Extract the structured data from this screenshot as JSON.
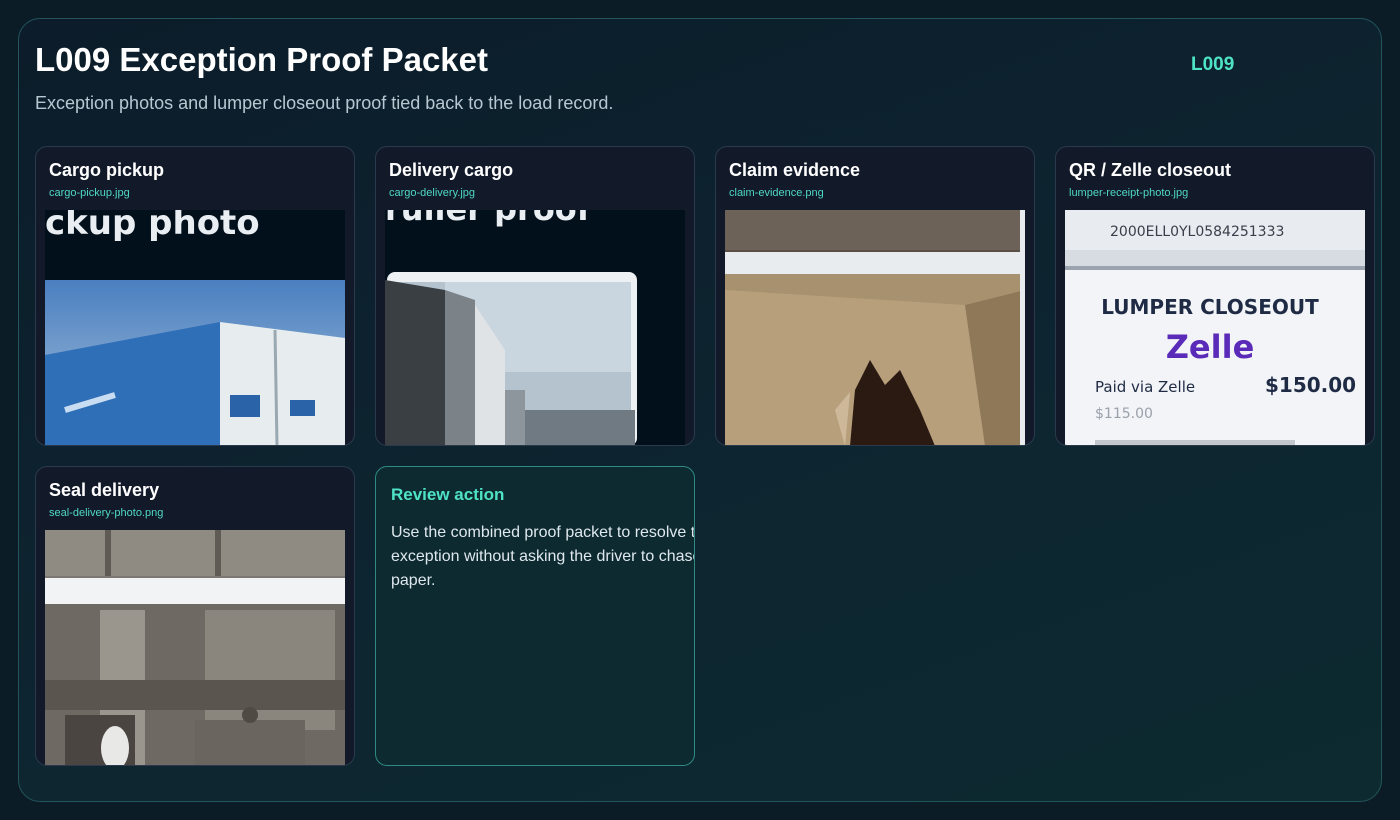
{
  "header": {
    "title": "L009 Exception Proof Packet",
    "load_id": "L009",
    "subtitle": "Exception photos and lumper closeout proof tied back to the load record."
  },
  "cards": [
    {
      "title": "Cargo pickup",
      "file": "cargo-pickup.jpg",
      "overlay_text": "ckup photo"
    },
    {
      "title": "Delivery cargo",
      "file": "cargo-delivery.jpg",
      "overlay_text": "ruller proof"
    },
    {
      "title": "Claim evidence",
      "file": "claim-evidence.png"
    },
    {
      "title": "QR / Zelle closeout",
      "file": "lumper-receipt-photo.jpg",
      "receipt": {
        "txn_id": "2000ELL0YL0584251333",
        "heading": "LUMPER CLOSEOUT",
        "brand": "Zelle",
        "paid_label": "Paid via Zelle",
        "amount": "$150.00",
        "sub_amount": "$115.00"
      }
    },
    {
      "title": "Seal delivery",
      "file": "seal-delivery-photo.png"
    }
  ],
  "review": {
    "title": "Review action",
    "text": "Use the combined proof packet to resolve the exception without asking the driver to chase paper."
  },
  "colors": {
    "accent": "#4fe3c6",
    "background": "#0b1c26",
    "card": "#121a2a",
    "zelle_purple": "#5a2ab8"
  }
}
